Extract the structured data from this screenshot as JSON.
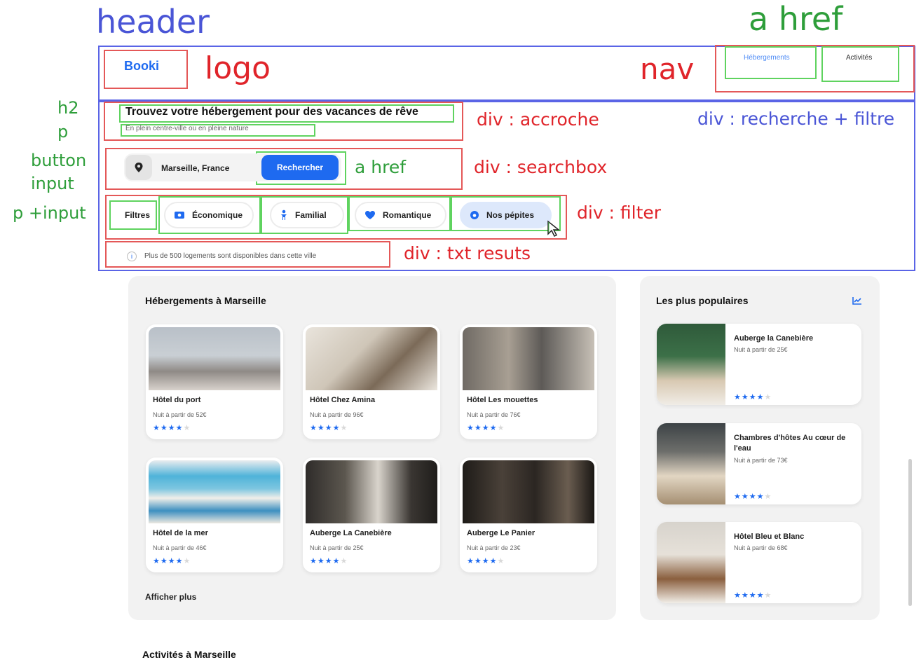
{
  "annotations": {
    "header": "header",
    "a_href_top": "a href",
    "logo": "logo",
    "nav": "nav",
    "h2": "h2",
    "p": "p",
    "button": "button",
    "input": "input",
    "p_input": "p +input",
    "div_accroche": "div : accroche",
    "div_recherche_filtre": "div : recherche + filtre",
    "div_searchbox": "div : searchbox",
    "a_href_search": "a href",
    "div_filter": "div : filter",
    "div_txt_results": "div : txt resuts"
  },
  "site": {
    "logo": "Booki",
    "nav": [
      {
        "label": "Hébergements",
        "active": true
      },
      {
        "label": "Activités",
        "active": false
      }
    ],
    "hero": {
      "title": "Trouvez votre hébergement pour des vacances de rêve",
      "subtitle": "En plein centre-ville ou en pleine nature"
    },
    "search": {
      "value": "Marseille, France",
      "button": "Rechercher",
      "icon": "location-pin-icon"
    },
    "filters": {
      "label": "Filtres",
      "chips": [
        {
          "label": "Économique",
          "icon": "money-icon",
          "selected": false
        },
        {
          "label": "Familial",
          "icon": "child-icon",
          "selected": false
        },
        {
          "label": "Romantique",
          "icon": "heart-icon",
          "selected": false
        },
        {
          "label": "Nos pépites",
          "icon": "gem-icon",
          "selected": true
        }
      ]
    },
    "results_text": "Plus de 500 logements sont disponibles dans cette ville",
    "accommodations": {
      "title": "Hébergements à Marseille",
      "items": [
        {
          "name": "Hôtel du port",
          "price": "Nuit à partir de 52€",
          "rating": 4
        },
        {
          "name": "Hôtel Chez Amina",
          "price": "Nuit à partir de 96€",
          "rating": 4
        },
        {
          "name": "Hôtel Les mouettes",
          "price": "Nuit à partir de 76€",
          "rating": 4
        },
        {
          "name": "Hôtel de la mer",
          "price": "Nuit à partir de 46€",
          "rating": 4
        },
        {
          "name": "Auberge La Canebière",
          "price": "Nuit à partir de 25€",
          "rating": 4
        },
        {
          "name": "Auberge Le Panier",
          "price": "Nuit à partir de 23€",
          "rating": 4
        }
      ],
      "more": "Afficher plus"
    },
    "popular": {
      "title": "Les plus populaires",
      "icon": "trend-chart-icon",
      "items": [
        {
          "name": "Auberge la Canebière",
          "price": "Nuit à partir de 25€",
          "rating": 4
        },
        {
          "name": "Chambres d'hôtes Au cœur de l'eau",
          "price": "Nuit à partir de 73€",
          "rating": 4
        },
        {
          "name": "Hôtel Bleu et Blanc",
          "price": "Nuit à partir de 68€",
          "rating": 4
        }
      ]
    },
    "next_section": "Activités à Marseille"
  }
}
